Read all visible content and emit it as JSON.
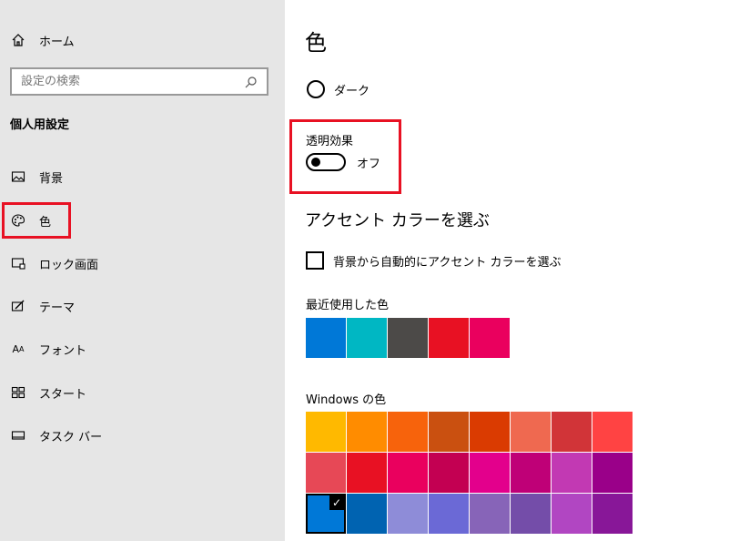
{
  "sidebar": {
    "home_label": "ホーム",
    "search_placeholder": "設定の検索",
    "section_title": "個人用設定",
    "items": [
      {
        "label": "背景",
        "icon": "picture-icon"
      },
      {
        "label": "色",
        "icon": "palette-icon",
        "active": true
      },
      {
        "label": "ロック画面",
        "icon": "lock-screen-icon"
      },
      {
        "label": "テーマ",
        "icon": "theme-icon"
      },
      {
        "label": "フォント",
        "icon": "font-icon"
      },
      {
        "label": "スタート",
        "icon": "start-icon"
      },
      {
        "label": "タスク バー",
        "icon": "taskbar-icon"
      }
    ]
  },
  "main": {
    "title": "色",
    "mode_option": "ダーク",
    "transparency_label": "透明効果",
    "transparency_state": "オフ",
    "accent_heading": "アクセント カラーを選ぶ",
    "auto_accent_label": "背景から自動的にアクセント カラーを選ぶ",
    "recent_label": "最近使用した色",
    "recent_colors": [
      "#0078d7",
      "#00b7c3",
      "#4c4a48",
      "#e81123",
      "#ea005e"
    ],
    "windows_label": "Windows の色",
    "windows_colors": [
      "#ffb900",
      "#ff8c00",
      "#f7630c",
      "#ca5010",
      "#da3b01",
      "#ef6950",
      "#d13438",
      "#ff4343",
      "#e74856",
      "#e81123",
      "#ea005e",
      "#c30052",
      "#e3008c",
      "#bf0077",
      "#c239b3",
      "#9a0089",
      "#0078d7",
      "#0063b1",
      "#8e8cd8",
      "#6b69d6",
      "#8764b8",
      "#744da9",
      "#b146c2",
      "#881798"
    ],
    "selected_color_index": 16
  }
}
